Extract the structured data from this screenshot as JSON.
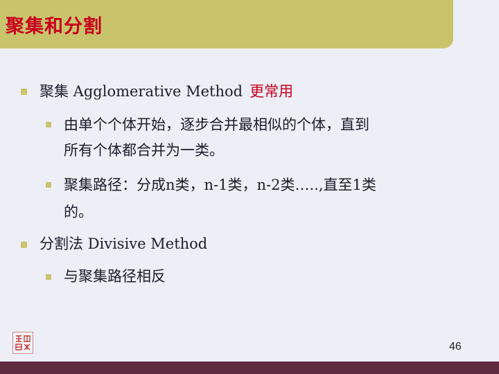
{
  "slide": {
    "title": "聚集和分割",
    "page_number": "46"
  },
  "content": {
    "item1": {
      "text": "聚集 Agglomerative Method",
      "highlight": "更常用",
      "sub1_line1": "由单个个体开始，逐步合并最相似的个体，直到",
      "sub1_line2": "所有个体都合并为一类。",
      "sub2_line1": "聚集路径：分成n类，n-1类，n-2类…..,直至1类",
      "sub2_line2": "的。"
    },
    "item2": {
      "text": "分割法 Divisive Method",
      "sub1_line1": "与聚集路径相反"
    }
  },
  "colors": {
    "accent_bar": "#c9c46c",
    "title_red": "#c8001e",
    "footer": "#5e2a3e",
    "background": "#eeeef6"
  },
  "icons": {
    "bullet": "square-bullet",
    "seal": "seal-stamp-logo"
  }
}
